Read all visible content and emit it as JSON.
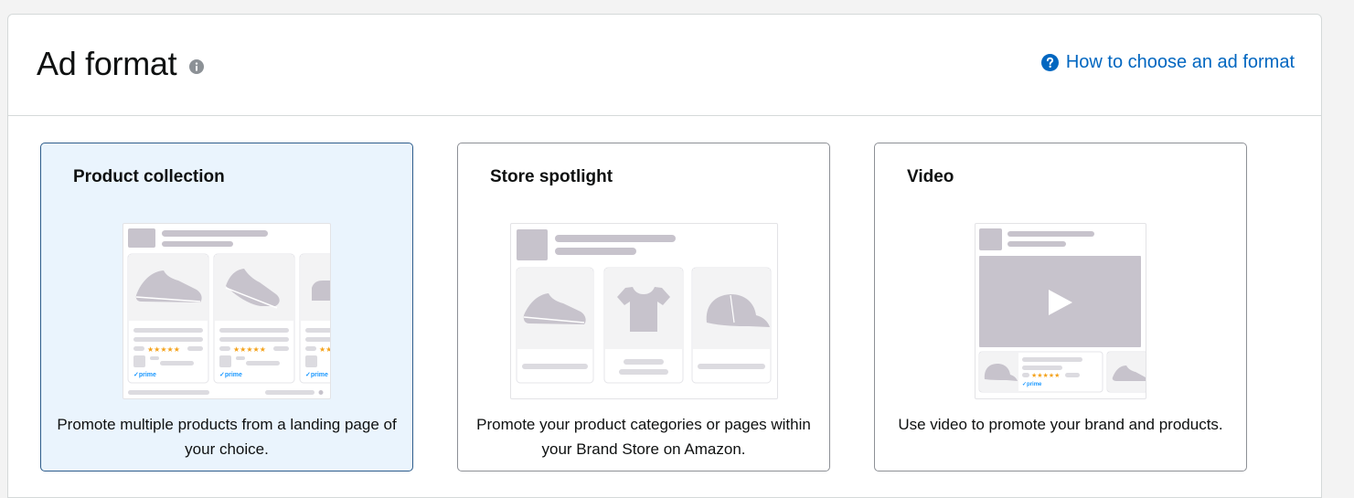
{
  "header": {
    "title": "Ad format",
    "info_icon": "info-icon",
    "help_icon": "question-circle-icon",
    "help_link": "How to choose an ad format"
  },
  "formats": [
    {
      "title": "Product collection",
      "description": "Promote multiple products from a landing page of your choice.",
      "illustration": "product-collection-illustration",
      "selected": true,
      "badges": [
        "prime",
        "prime",
        "prime"
      ]
    },
    {
      "title": "Store spotlight",
      "description": "Promote your product categories or pages within your Brand Store on Amazon.",
      "illustration": "store-spotlight-illustration",
      "selected": false
    },
    {
      "title": "Video",
      "description": "Use video to promote your brand and products.",
      "illustration": "video-illustration",
      "selected": false,
      "badges": [
        "prime"
      ]
    }
  ],
  "colors": {
    "link": "#0066c0",
    "selected_bg": "#eaf4fd",
    "selected_border": "#2d5c8b",
    "placeholder": "#c7c3cc",
    "star": "#f4a31d",
    "prime": "#1a98ff"
  }
}
